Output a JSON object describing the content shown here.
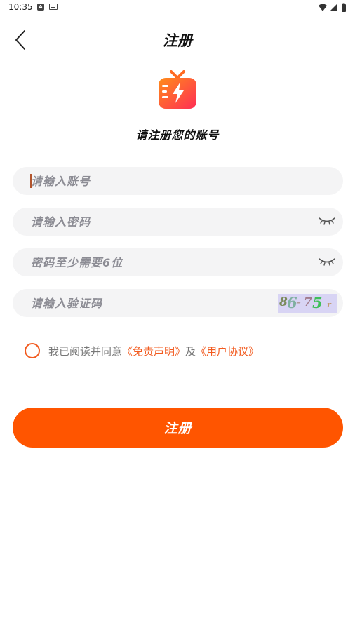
{
  "status_bar": {
    "time": "10:35",
    "a_label": "A"
  },
  "header": {
    "title": "注册"
  },
  "subtitle": "请注册您的账号",
  "form": {
    "account_placeholder": "请输入账号",
    "password_placeholder": "请输入密码",
    "password_hint_placeholder": "密码至少需要6位",
    "captcha_placeholder": "请输入验证码",
    "captcha_chars": [
      "8",
      "6",
      "-",
      "7",
      "5",
      "r"
    ]
  },
  "agreement": {
    "prefix": "我已阅读并同意",
    "disclaimer_link": "《免责声明》",
    "connector": "及",
    "user_agreement_link": "《用户协议》"
  },
  "submit_label": "注册",
  "colors": {
    "accent": "#ff5500",
    "link": "#f25a1e",
    "field_bg": "#f4f4f5"
  },
  "icons": [
    "back-arrow-icon",
    "tv-logo-icon",
    "eye-closed-icon",
    "wifi-icon",
    "signal-icon",
    "battery-icon"
  ]
}
